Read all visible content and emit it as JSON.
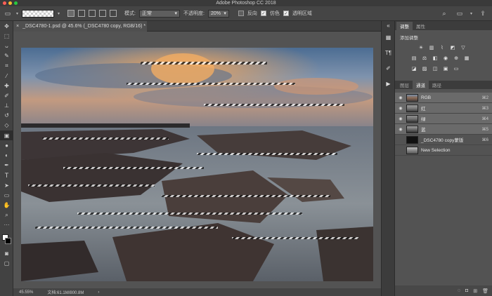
{
  "app": {
    "title": "Adobe Photoshop CC 2018"
  },
  "options_bar": {
    "mode_label": "模式:",
    "mode_value": "正常",
    "opacity_label": "不透明度:",
    "opacity_value": "20%",
    "reverse_label": "反向",
    "dither_label": "仿色",
    "transparency_label": "透明区域"
  },
  "document": {
    "tab_title": "_DSC4780-1.psd @ 45.6% (_DSC4780 copy, RGB/16) *",
    "zoom": "45.55%",
    "doc_size": "文档:61.1M/800.8M"
  },
  "panels": {
    "top_tabs": [
      "调整",
      "属性"
    ],
    "add_adjustment": "添加调整",
    "channel_tabs": [
      "图层",
      "通道",
      "路径"
    ],
    "channels": [
      {
        "name": "RGB",
        "shortcut": "⌘2"
      },
      {
        "name": "红",
        "shortcut": "⌘3"
      },
      {
        "name": "绿",
        "shortcut": "⌘4"
      },
      {
        "name": "蓝",
        "shortcut": "⌘5"
      },
      {
        "name": "_DSC4780 copy蒙版",
        "shortcut": "⌘6"
      },
      {
        "name": "New Selection",
        "shortcut": ""
      }
    ]
  },
  "colors": {
    "accent": "#3a3a3a",
    "panel": "#535353"
  },
  "icons": {
    "toolbar": [
      "move-icon",
      "marquee-icon",
      "lasso-icon",
      "quick-select-icon",
      "crop-icon",
      "eyedropper-icon",
      "healing-icon",
      "brush-icon",
      "stamp-icon",
      "history-brush-icon",
      "eraser-icon",
      "gradient-icon",
      "blur-icon",
      "dodge-icon",
      "pen-icon",
      "type-icon",
      "path-select-icon",
      "shape-icon",
      "hand-icon",
      "zoom-icon"
    ]
  }
}
